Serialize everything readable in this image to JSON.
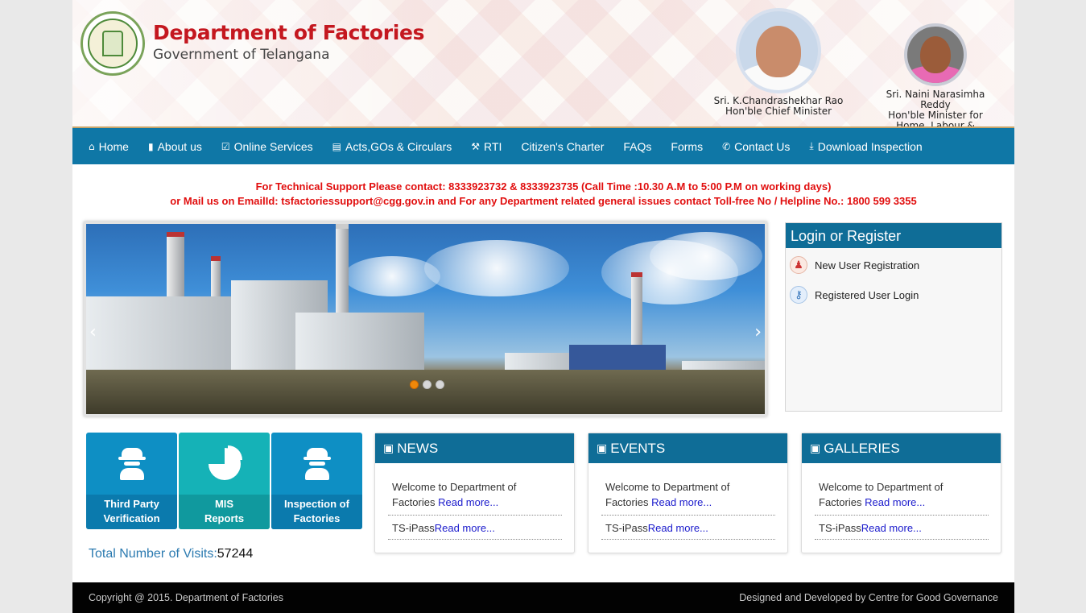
{
  "header": {
    "title": "Department of Factories",
    "subtitle": "Government of Telangana",
    "chief_minister": {
      "name": "Sri. K.Chandrashekhar Rao",
      "role": "Hon'ble Chief Minister"
    },
    "minister": {
      "name": "Sri. Naini Narasimha Reddy",
      "role": "Hon'ble Minister for Home, Labour & Employment"
    }
  },
  "nav": {
    "items": [
      {
        "label": "Home",
        "icon": "home-icon"
      },
      {
        "label": "About us",
        "icon": "book-icon"
      },
      {
        "label": "Online Services",
        "icon": "checkbox-icon"
      },
      {
        "label": "Acts,GOs & Circulars",
        "icon": "document-icon"
      },
      {
        "label": "RTI",
        "icon": "gavel-icon"
      },
      {
        "label": "Citizen's Charter",
        "icon": ""
      },
      {
        "label": "FAQs",
        "icon": ""
      },
      {
        "label": "Forms",
        "icon": ""
      },
      {
        "label": "Contact Us",
        "icon": "phone-icon"
      },
      {
        "label": "Download Inspection",
        "icon": "download-icon"
      }
    ]
  },
  "notice": {
    "line1": "For Technical Support Please contact: 8333923732 & 8333923735 (Call Time :10.30 A.M to 5:00 P.M on working days)",
    "line2": "or Mail us on EmailId: tsfactoriessupport@cgg.gov.in and For any Department related general issues contact Toll-free No / Helpline No.: 1800 599 3355"
  },
  "slider": {
    "slide_count": 3,
    "active_slide": 1
  },
  "login": {
    "title": "Login or Register",
    "new_user": "New User Registration",
    "registered": "Registered User Login"
  },
  "tiles": [
    {
      "line1": "Third Party",
      "line2": "Verification"
    },
    {
      "line1": "MIS",
      "line2": "Reports"
    },
    {
      "line1": "Inspection of",
      "line2": "Factories"
    }
  ],
  "visits": {
    "label": "Total Number of Visits:",
    "count": "57244"
  },
  "boxes": {
    "news": {
      "title": "NEWS",
      "item1_text": "Welcome to Department of Factories",
      "item2_text": "TS-iPass",
      "read_more": "Read more..."
    },
    "events": {
      "title": "EVENTS",
      "item1_text": "Welcome to Department of Factories",
      "item2_text": "TS-iPass",
      "read_more": "Read more..."
    },
    "galleries": {
      "title": "GALLERIES",
      "item1_text": "Welcome to Department of Factories",
      "item2_text": "TS-iPass",
      "read_more": "Read more..."
    }
  },
  "footer": {
    "copyright": "Copyright @ 2015. Department of Factories",
    "credit": "Designed and Developed by Centre for Good Governance"
  },
  "colors": {
    "nav": "#0f77a6",
    "title_red": "#c4171f",
    "notice_red": "#e10e0e",
    "panel_head": "#0f6d97",
    "tile_blue": "#0e8fc4",
    "tile_teal": "#15b2b7",
    "active_dot": "#f0880a"
  }
}
